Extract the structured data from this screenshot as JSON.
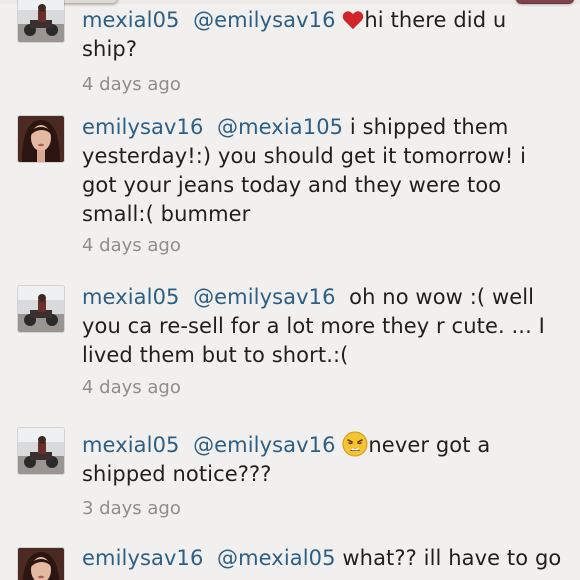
{
  "comments": [
    {
      "username": "mexial05",
      "mention": "@emilysav16",
      "pre_icon": "",
      "icon": "heart-icon",
      "body": "hi there did u ship?",
      "line2": "ship?",
      "line1": "hi there did u",
      "time": "4 days ago",
      "avatar": "motorcycle-avatar"
    },
    {
      "username": "emilysav16",
      "mention": "@mexia105",
      "lines": [
        " i shipped them",
        "yesterday!:) you should get it tomorrow! i",
        "got your jeans today and they were too",
        "small:( bummer"
      ],
      "time": "4 days ago",
      "avatar": "woman-avatar"
    },
    {
      "username": "mexial05",
      "mention": "@emilysav16",
      "lines": [
        "  oh no wow :( well",
        "you ca re-sell for a lot more they r cute. ... I",
        "lived them but to short.:("
      ],
      "time": "4 days ago",
      "avatar": "motorcycle-avatar"
    },
    {
      "username": "mexial05",
      "mention": "@emilysav16",
      "icon": "weary-face-icon",
      "line1": "never got a",
      "line2": "shipped notice???",
      "time": "3 days ago",
      "avatar": "motorcycle-avatar"
    },
    {
      "username": "emilysav16",
      "mention": "@mexial05",
      "line1": " what?? ill have to go",
      "avatar": "woman-avatar"
    }
  ],
  "colors": {
    "username": "#2c5f86",
    "body": "#1f1f1f",
    "time": "#8e8e8e",
    "background": "#f2f0ee"
  }
}
